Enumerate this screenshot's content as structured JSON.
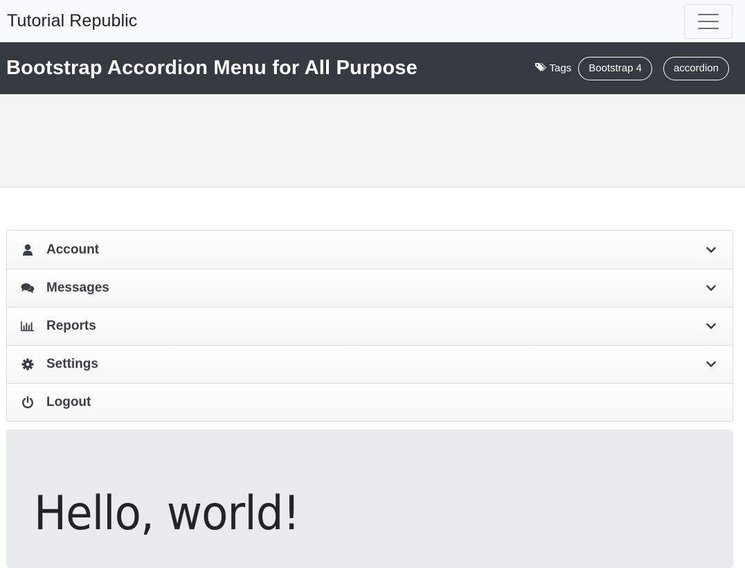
{
  "navbar": {
    "brand": "Tutorial Republic"
  },
  "header": {
    "title": "Bootstrap Accordion Menu for All Purpose",
    "tags_label": "Tags",
    "tags": [
      "Bootstrap 4",
      "accordion"
    ]
  },
  "accordion": {
    "items": [
      {
        "label": "Account",
        "icon": "user-icon",
        "expandable": true
      },
      {
        "label": "Messages",
        "icon": "comments-icon",
        "expandable": true
      },
      {
        "label": "Reports",
        "icon": "bar-chart-icon",
        "expandable": true
      },
      {
        "label": "Settings",
        "icon": "gear-icon",
        "expandable": true
      },
      {
        "label": "Logout",
        "icon": "power-icon",
        "expandable": false
      }
    ]
  },
  "jumbotron": {
    "title": "Hello, world!"
  },
  "colors": {
    "navbar_bg": "#f8f9fa",
    "titlebar_bg": "#343a40",
    "accent_text": "#3a4047",
    "jumbotron_bg": "#e9ecef"
  }
}
